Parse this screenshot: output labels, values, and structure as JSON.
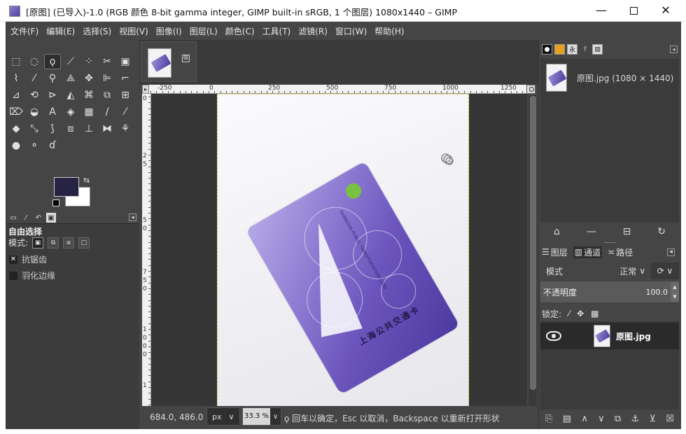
{
  "window": {
    "title": "[原图] (已导入)-1.0 (RGB 颜色 8-bit gamma integer, GIMP built-in sRGB, 1 个图层) 1080x1440 – GIMP",
    "minimize": "—",
    "close": "✕"
  },
  "menubar": [
    "文件(F)",
    "编辑(E)",
    "选择(S)",
    "视图(V)",
    "图像(I)",
    "图层(L)",
    "颜色(C)",
    "工具(T)",
    "滤镜(R)",
    "窗口(W)",
    "帮助(H)"
  ],
  "toolbox": {
    "tools": [
      {
        "name": "rect-select-icon",
        "glyph": "⬚"
      },
      {
        "name": "ellipse-select-icon",
        "glyph": "◌"
      },
      {
        "name": "free-select-icon",
        "glyph": "ϙ",
        "active": true
      },
      {
        "name": "fuzzy-select-icon",
        "glyph": "⟋"
      },
      {
        "name": "by-color-select-icon",
        "glyph": "⁘"
      },
      {
        "name": "scissors-select-icon",
        "glyph": "✂"
      },
      {
        "name": "foreground-select-icon",
        "glyph": "▣"
      },
      {
        "name": "paths-icon",
        "glyph": "⌇"
      },
      {
        "name": "color-picker-icon",
        "glyph": "⁄"
      },
      {
        "name": "zoom-icon",
        "glyph": "⚲"
      },
      {
        "name": "measure-icon",
        "glyph": "⟁"
      },
      {
        "name": "move-icon",
        "glyph": "✥"
      },
      {
        "name": "align-icon",
        "glyph": "⊫"
      },
      {
        "name": "crop-icon",
        "glyph": "⌐"
      },
      {
        "name": "unified-transform-icon",
        "glyph": "⊿"
      },
      {
        "name": "rotate-icon",
        "glyph": "⟲"
      },
      {
        "name": "shear-icon",
        "glyph": "⊳"
      },
      {
        "name": "perspective-icon",
        "glyph": "◭"
      },
      {
        "name": "warp-icon",
        "glyph": "⌘"
      },
      {
        "name": "3d-transform-icon",
        "glyph": "⧉"
      },
      {
        "name": "handle-transform-icon",
        "glyph": "⊞"
      },
      {
        "name": "cage-transform-icon",
        "glyph": "⌦"
      },
      {
        "name": "bucket-fill-icon",
        "glyph": "◒"
      },
      {
        "name": "text-icon",
        "glyph": "A"
      },
      {
        "name": "gradient-icon",
        "glyph": "◈"
      },
      {
        "name": "mypaint-brush-icon",
        "glyph": "▦"
      },
      {
        "name": "pencil-icon",
        "glyph": "∕"
      },
      {
        "name": "paintbrush-icon",
        "glyph": "⁄"
      },
      {
        "name": "eraser-icon",
        "glyph": "◆"
      },
      {
        "name": "airbrush-icon",
        "glyph": "⤡"
      },
      {
        "name": "ink-icon",
        "glyph": "⟆"
      },
      {
        "name": "clone-icon",
        "glyph": "⧈"
      },
      {
        "name": "heal-icon",
        "glyph": "⊥"
      },
      {
        "name": "perspective-clone-icon",
        "glyph": "⧓"
      },
      {
        "name": "blur-icon",
        "glyph": "⚘"
      },
      {
        "name": "dodge-burn-icon",
        "glyph": "●"
      },
      {
        "name": "smudge-icon",
        "glyph": "⚬"
      },
      {
        "name": "dodge-icon",
        "glyph": "ɗ"
      }
    ],
    "fg_color": "#262345",
    "bg_color": "#ffffff",
    "swap_glyph": "⇆"
  },
  "tool_options": {
    "title": "自由选择",
    "mode_label": "模式:",
    "antialias_label": "抗锯齿",
    "antialias_checked": "✕",
    "feather_label": "羽化边缘",
    "menu_glyph": "◂"
  },
  "canvas": {
    "tab_close": "⊠",
    "ruler_h_labels": [
      "-250",
      "0",
      "250",
      "500",
      "750",
      "1000",
      "1250"
    ],
    "ruler_v_labels": [
      "0",
      "2",
      "5",
      "5",
      "0",
      "7",
      "5",
      "0",
      "1",
      "0",
      "0",
      "0",
      "1"
    ],
    "card_text": "上海公共交通卡",
    "card_small": "SHANGHAI PUBLIC TRANSPORTATION CARD",
    "nav_glyph": "◭"
  },
  "statusbar": {
    "coords": "684.0, 486.0",
    "unit": "px",
    "unit_arrow": "∨",
    "zoom": "33.3 %",
    "zoom_arrow": "∨",
    "message": "回车以确定，Esc 以取消，Backspace 以重新打开形状"
  },
  "dock": {
    "image_name": "原图.jpg (1080 × 1440)",
    "layers_tab": "图层",
    "channels_tab": "通道",
    "paths_tab": "路径",
    "mode_label": "模式",
    "mode_value": "正常",
    "mode_chev": "∨",
    "mode_extra": "⟳ ∨",
    "opacity_label": "不透明度",
    "opacity_value": "100.0",
    "lock_label": "锁定:",
    "layer_name": "原图.jpg",
    "dock_menu": "◂"
  }
}
